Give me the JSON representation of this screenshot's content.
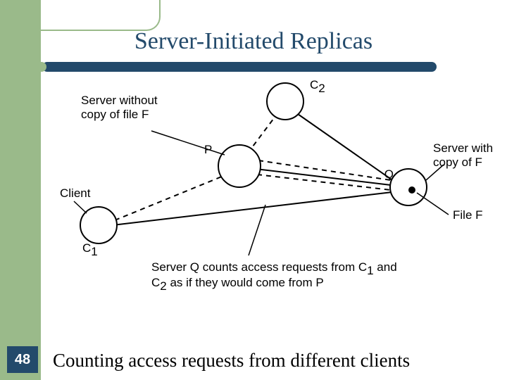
{
  "slide": {
    "title": "Server-Initiated Replicas",
    "number": "48",
    "caption": "Counting access requests from different clients"
  },
  "diagram": {
    "labels": {
      "server_without": "Server without\ncopy of file F",
      "client": "Client",
      "server_with": "Server with\ncopy of F",
      "file_f": "File F",
      "note_line1": "Server Q counts access requests from C",
      "note_sub1": "1",
      "note_mid": " and",
      "note_line2": "C",
      "note_sub2": "2",
      "note_rest": " as if they would come from P"
    },
    "nodes": {
      "P": "P",
      "Q": "Q",
      "C1": "C",
      "C1_sub": "1",
      "C2": "C",
      "C2_sub": "2"
    }
  }
}
